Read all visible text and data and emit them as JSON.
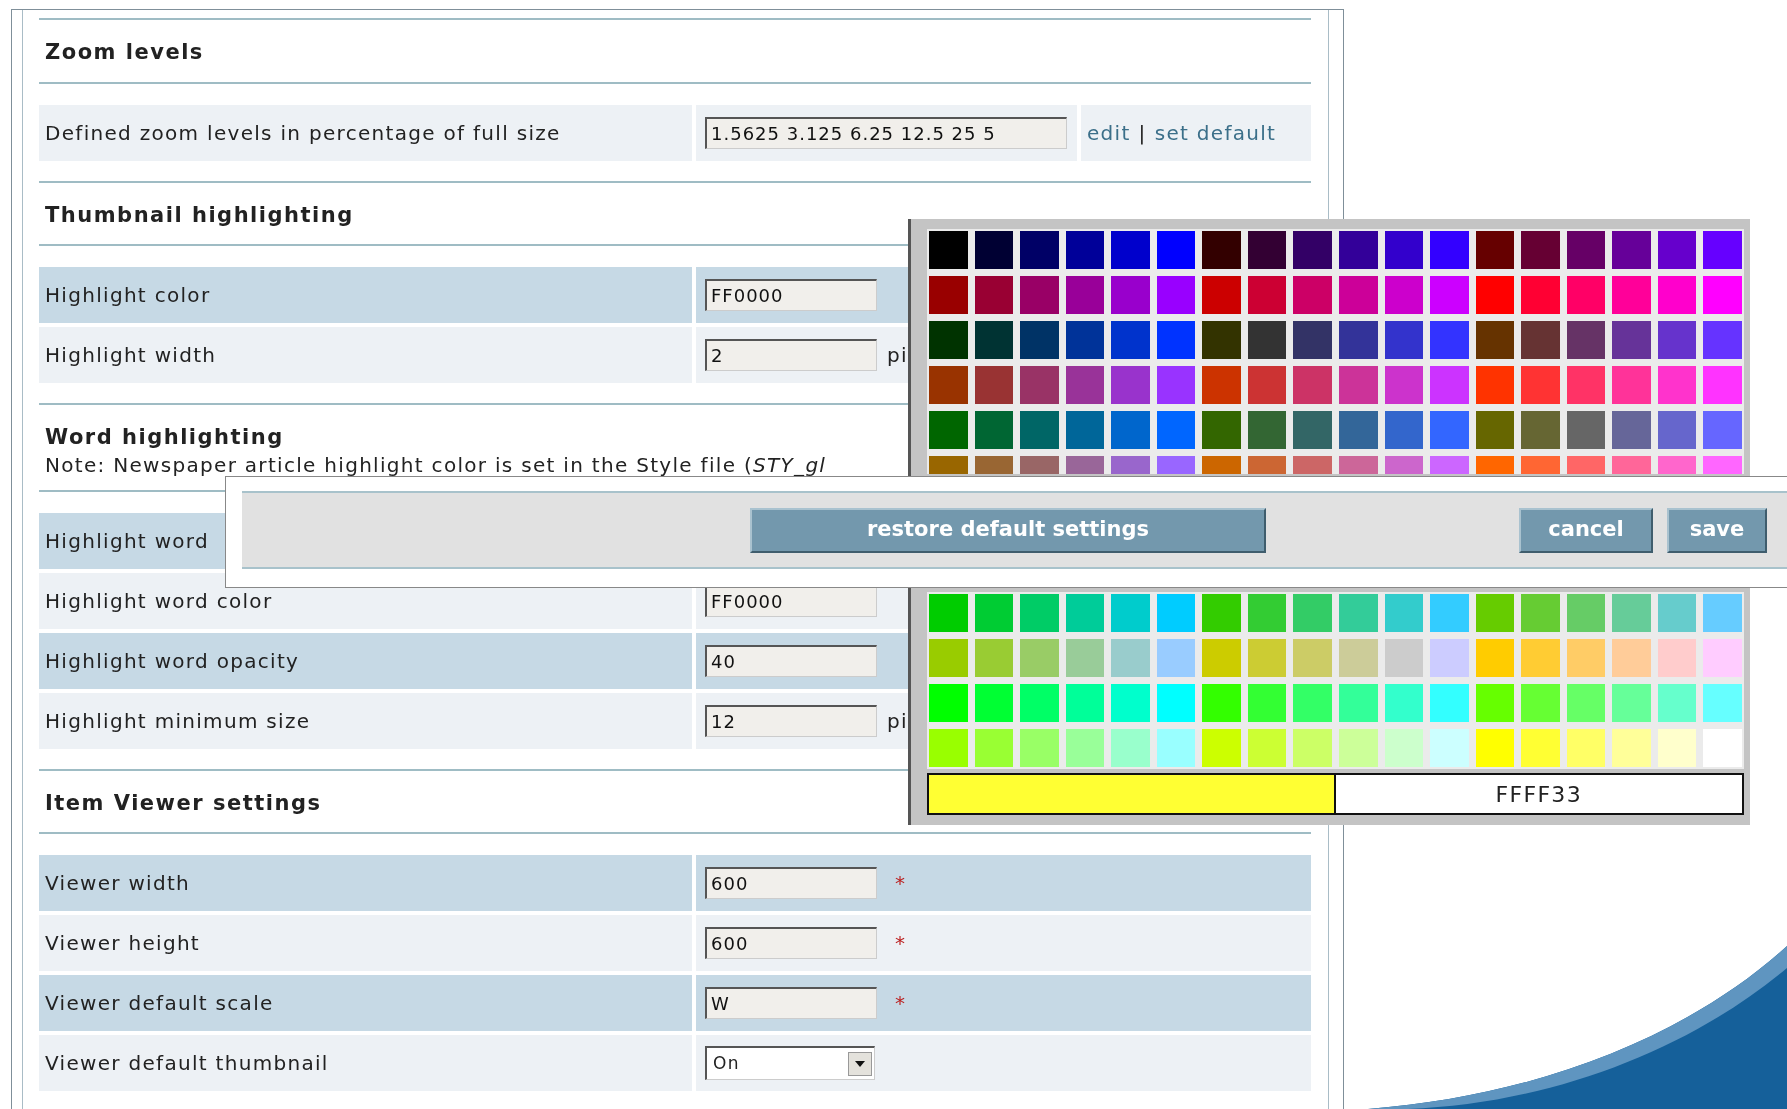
{
  "sections": [
    {
      "title": "Zoom levels",
      "rows": [
        {
          "label": "Defined zoom levels in percentage of full size",
          "field": {
            "kind": "text",
            "value": "1.5625 3.125 6.25 12.5 25 5"
          },
          "links": [
            {
              "label": "edit"
            },
            {
              "label": "set default"
            }
          ],
          "separator": "|"
        }
      ]
    },
    {
      "title": "Thumbnail highlighting",
      "rows": [
        {
          "label": "Highlight color",
          "field": {
            "kind": "text",
            "value": "FF0000"
          }
        },
        {
          "label": "Highlight width",
          "field": {
            "kind": "text",
            "value": "2"
          },
          "unit": "pi"
        }
      ]
    },
    {
      "title": "Word highlighting",
      "note": "Note: Newspaper article highlight color is set in the Style file (*STY_gl*",
      "rows": [
        {
          "label": "Highlight word"
        },
        {
          "label": "Highlight word color",
          "field": {
            "kind": "text",
            "value": "FF0000"
          }
        },
        {
          "label": "Highlight word opacity",
          "field": {
            "kind": "text",
            "value": "40"
          }
        },
        {
          "label": "Highlight minimum size",
          "field": {
            "kind": "text",
            "value": "12"
          },
          "unit": "pi"
        }
      ]
    },
    {
      "title": "Item Viewer settings",
      "rows": [
        {
          "label": "Viewer width",
          "field": {
            "kind": "text",
            "value": "600"
          },
          "required_mark": "*"
        },
        {
          "label": "Viewer height",
          "field": {
            "kind": "text",
            "value": "600"
          },
          "required_mark": "*"
        },
        {
          "label": "Viewer default scale",
          "field": {
            "kind": "text",
            "value": "W"
          },
          "required_mark": "*"
        },
        {
          "label": "Viewer default thumbnail",
          "field": {
            "kind": "select",
            "value": "On"
          }
        }
      ]
    }
  ],
  "color_picker": {
    "upper_rows": [
      {
        "swatches": [
          {
            "color": "#000000"
          },
          {
            "color": "#000033"
          },
          {
            "color": "#000066"
          },
          {
            "color": "#000099"
          },
          {
            "color": "#0000cc"
          },
          {
            "color": "#0000ff"
          },
          {
            "color": "#330000"
          },
          {
            "color": "#330033"
          },
          {
            "color": "#330066"
          },
          {
            "color": "#330099"
          },
          {
            "color": "#3300cc"
          },
          {
            "color": "#3300ff"
          },
          {
            "color": "#660000"
          },
          {
            "color": "#660033"
          },
          {
            "color": "#660066"
          },
          {
            "color": "#660099"
          },
          {
            "color": "#6600cc"
          },
          {
            "color": "#6600ff"
          }
        ]
      },
      {
        "swatches": [
          {
            "color": "#990000"
          },
          {
            "color": "#990033"
          },
          {
            "color": "#990066"
          },
          {
            "color": "#990099"
          },
          {
            "color": "#9900cc"
          },
          {
            "color": "#9900ff"
          },
          {
            "color": "#cc0000"
          },
          {
            "color": "#cc0033"
          },
          {
            "color": "#cc0066"
          },
          {
            "color": "#cc0099"
          },
          {
            "color": "#cc00cc"
          },
          {
            "color": "#cc00ff"
          },
          {
            "color": "#ff0000"
          },
          {
            "color": "#ff0033"
          },
          {
            "color": "#ff0066"
          },
          {
            "color": "#ff0099"
          },
          {
            "color": "#ff00cc"
          },
          {
            "color": "#ff00ff"
          }
        ]
      },
      {
        "swatches": [
          {
            "color": "#003300"
          },
          {
            "color": "#003333"
          },
          {
            "color": "#003366"
          },
          {
            "color": "#003399"
          },
          {
            "color": "#0033cc"
          },
          {
            "color": "#0033ff"
          },
          {
            "color": "#333300"
          },
          {
            "color": "#333333"
          },
          {
            "color": "#333366"
          },
          {
            "color": "#333399"
          },
          {
            "color": "#3333cc"
          },
          {
            "color": "#3333ff"
          },
          {
            "color": "#663300"
          },
          {
            "color": "#663333"
          },
          {
            "color": "#663366"
          },
          {
            "color": "#663399"
          },
          {
            "color": "#6633cc"
          },
          {
            "color": "#6633ff"
          }
        ]
      },
      {
        "swatches": [
          {
            "color": "#993300"
          },
          {
            "color": "#993333"
          },
          {
            "color": "#993366"
          },
          {
            "color": "#993399"
          },
          {
            "color": "#9933cc"
          },
          {
            "color": "#9933ff"
          },
          {
            "color": "#cc3300"
          },
          {
            "color": "#cc3333"
          },
          {
            "color": "#cc3366"
          },
          {
            "color": "#cc3399"
          },
          {
            "color": "#cc33cc"
          },
          {
            "color": "#cc33ff"
          },
          {
            "color": "#ff3300"
          },
          {
            "color": "#ff3333"
          },
          {
            "color": "#ff3366"
          },
          {
            "color": "#ff3399"
          },
          {
            "color": "#ff33cc"
          },
          {
            "color": "#ff33ff"
          }
        ]
      },
      {
        "swatches": [
          {
            "color": "#006600"
          },
          {
            "color": "#006633"
          },
          {
            "color": "#006666"
          },
          {
            "color": "#006699"
          },
          {
            "color": "#0066cc"
          },
          {
            "color": "#0066ff"
          },
          {
            "color": "#336600"
          },
          {
            "color": "#336633"
          },
          {
            "color": "#336666"
          },
          {
            "color": "#336699"
          },
          {
            "color": "#3366cc"
          },
          {
            "color": "#3366ff"
          },
          {
            "color": "#666600"
          },
          {
            "color": "#666633"
          },
          {
            "color": "#666666"
          },
          {
            "color": "#666699"
          },
          {
            "color": "#6666cc"
          },
          {
            "color": "#6666ff"
          }
        ]
      },
      {
        "swatches": [
          {
            "color": "#996600"
          },
          {
            "color": "#996633"
          },
          {
            "color": "#996666"
          },
          {
            "color": "#996699"
          },
          {
            "color": "#9966cc"
          },
          {
            "color": "#9966ff"
          },
          {
            "color": "#cc6600"
          },
          {
            "color": "#cc6633"
          },
          {
            "color": "#cc6666"
          },
          {
            "color": "#cc6699"
          },
          {
            "color": "#cc66cc"
          },
          {
            "color": "#cc66ff"
          },
          {
            "color": "#ff6600"
          },
          {
            "color": "#ff6633"
          },
          {
            "color": "#ff6666"
          },
          {
            "color": "#ff6699"
          },
          {
            "color": "#ff66cc"
          },
          {
            "color": "#ff66ff"
          }
        ]
      }
    ],
    "lower_rows": [
      {
        "swatches": [
          {
            "color": "#00cc00"
          },
          {
            "color": "#00cc33"
          },
          {
            "color": "#00cc66"
          },
          {
            "color": "#00cc99"
          },
          {
            "color": "#00cccc"
          },
          {
            "color": "#00ccff"
          },
          {
            "color": "#33cc00"
          },
          {
            "color": "#33cc33"
          },
          {
            "color": "#33cc66"
          },
          {
            "color": "#33cc99"
          },
          {
            "color": "#33cccc"
          },
          {
            "color": "#33ccff"
          },
          {
            "color": "#66cc00"
          },
          {
            "color": "#66cc33"
          },
          {
            "color": "#66cc66"
          },
          {
            "color": "#66cc99"
          },
          {
            "color": "#66cccc"
          },
          {
            "color": "#66ccff"
          }
        ]
      },
      {
        "swatches": [
          {
            "color": "#99cc00"
          },
          {
            "color": "#99cc33"
          },
          {
            "color": "#99cc66"
          },
          {
            "color": "#99cc99"
          },
          {
            "color": "#99cccc"
          },
          {
            "color": "#99ccff"
          },
          {
            "color": "#cccc00"
          },
          {
            "color": "#cccc33"
          },
          {
            "color": "#cccc66"
          },
          {
            "color": "#cccc99"
          },
          {
            "color": "#cccccc"
          },
          {
            "color": "#ccccff"
          },
          {
            "color": "#ffcc00"
          },
          {
            "color": "#ffcc33"
          },
          {
            "color": "#ffcc66"
          },
          {
            "color": "#ffcc99"
          },
          {
            "color": "#ffcccc"
          },
          {
            "color": "#ffccff"
          }
        ]
      },
      {
        "swatches": [
          {
            "color": "#00ff00"
          },
          {
            "color": "#00ff33"
          },
          {
            "color": "#00ff66"
          },
          {
            "color": "#00ff99"
          },
          {
            "color": "#00ffcc"
          },
          {
            "color": "#00ffff"
          },
          {
            "color": "#33ff00"
          },
          {
            "color": "#33ff33"
          },
          {
            "color": "#33ff66"
          },
          {
            "color": "#33ff99"
          },
          {
            "color": "#33ffcc"
          },
          {
            "color": "#33ffff"
          },
          {
            "color": "#66ff00"
          },
          {
            "color": "#66ff33"
          },
          {
            "color": "#66ff66"
          },
          {
            "color": "#66ff99"
          },
          {
            "color": "#66ffcc"
          },
          {
            "color": "#66ffff"
          }
        ]
      },
      {
        "swatches": [
          {
            "color": "#99ff00"
          },
          {
            "color": "#99ff33"
          },
          {
            "color": "#99ff66"
          },
          {
            "color": "#99ff99"
          },
          {
            "color": "#99ffcc"
          },
          {
            "color": "#99ffff"
          },
          {
            "color": "#ccff00"
          },
          {
            "color": "#ccff33"
          },
          {
            "color": "#ccff66"
          },
          {
            "color": "#ccff99"
          },
          {
            "color": "#ccffcc"
          },
          {
            "color": "#ccffff"
          },
          {
            "color": "#ffff00"
          },
          {
            "color": "#ffff33"
          },
          {
            "color": "#ffff66"
          },
          {
            "color": "#ffff99"
          },
          {
            "color": "#ffffcc"
          },
          {
            "color": "#ffffff"
          }
        ]
      }
    ],
    "selected": {
      "color": "#ffff33",
      "code": "FFFF33"
    }
  },
  "toolbar": {
    "buttons": [
      {
        "kind": "restore",
        "label": "restore default settings"
      },
      {
        "kind": "cancel",
        "label": "cancel"
      },
      {
        "kind": "save",
        "label": "save"
      }
    ]
  }
}
